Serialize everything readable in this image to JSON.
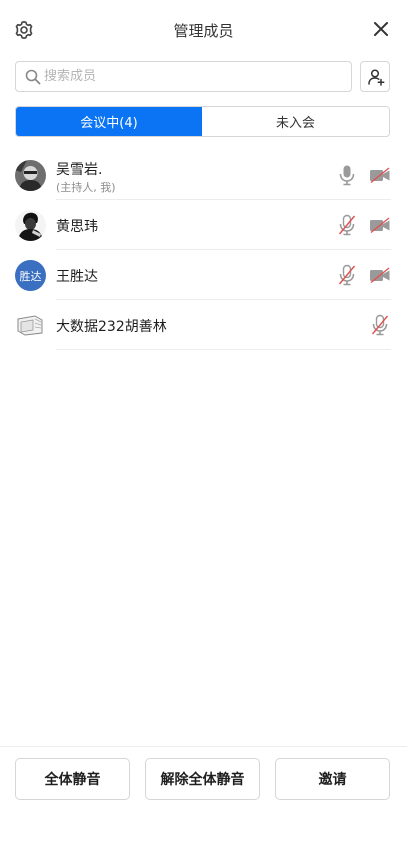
{
  "header": {
    "title": "管理成员",
    "settings_icon": "gear-icon",
    "close_icon": "close-icon"
  },
  "search": {
    "placeholder": "搜索成员",
    "value": ""
  },
  "tabs": [
    {
      "label": "会议中(4)",
      "active": true
    },
    {
      "label": "未入会",
      "active": false
    }
  ],
  "members": [
    {
      "name": "吴雪岩.",
      "sub": "(主持人, 我)",
      "avatar": "photo-dark",
      "mic": "on",
      "camera": "off"
    },
    {
      "name": "黄思玮",
      "sub": "",
      "avatar": "photo-bw",
      "mic": "muted",
      "camera": "off"
    },
    {
      "name": "王胜达",
      "sub": "",
      "avatar_text": "胜达",
      "mic": "muted",
      "camera": "off"
    },
    {
      "name": "大数据232胡善林",
      "sub": "",
      "avatar": "photo-sketch",
      "mic": "muted",
      "camera": null
    }
  ],
  "footer": {
    "mute_all": "全体静音",
    "unmute_all": "解除全体静音",
    "invite": "邀请"
  },
  "colors": {
    "accent": "#0a74f5",
    "muted_red": "#e05050",
    "icon_gray": "#9a9a9a",
    "avatar_blue": "#3a6fc2"
  }
}
